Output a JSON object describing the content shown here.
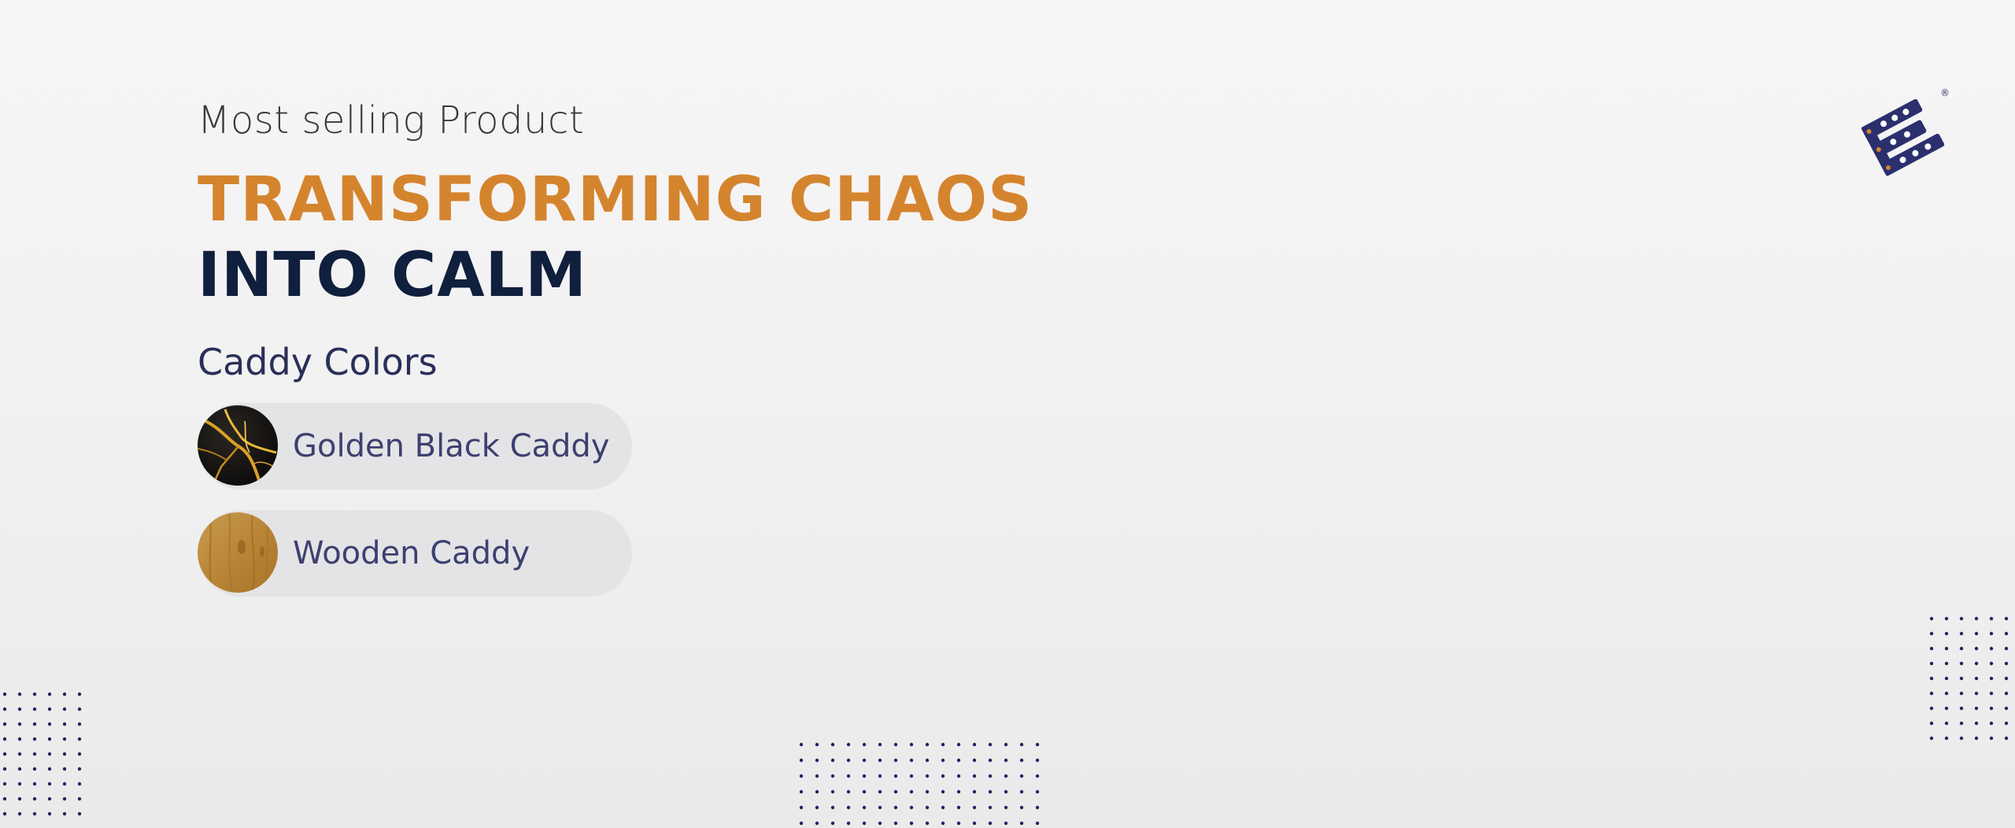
{
  "hero": {
    "subtitle": "Most selling Product",
    "headline_line1": "TRANSFORMING CHAOS",
    "headline_line2": "INTO CALM"
  },
  "colors_section": {
    "label": "Caddy Colors",
    "options": [
      {
        "label": "Golden Black Caddy",
        "swatch": "golden-black-marble"
      },
      {
        "label": "Wooden Caddy",
        "swatch": "wood-grain"
      }
    ]
  },
  "logo": {
    "registered_mark": "®"
  },
  "palette": {
    "accent": "#d5842e",
    "navy": "#0f1f3d",
    "label_text": "#3d4070",
    "pill_bg": "#e4e4e6",
    "logo_blue": "#2b2f6e",
    "dot_color": "#1e2560"
  }
}
